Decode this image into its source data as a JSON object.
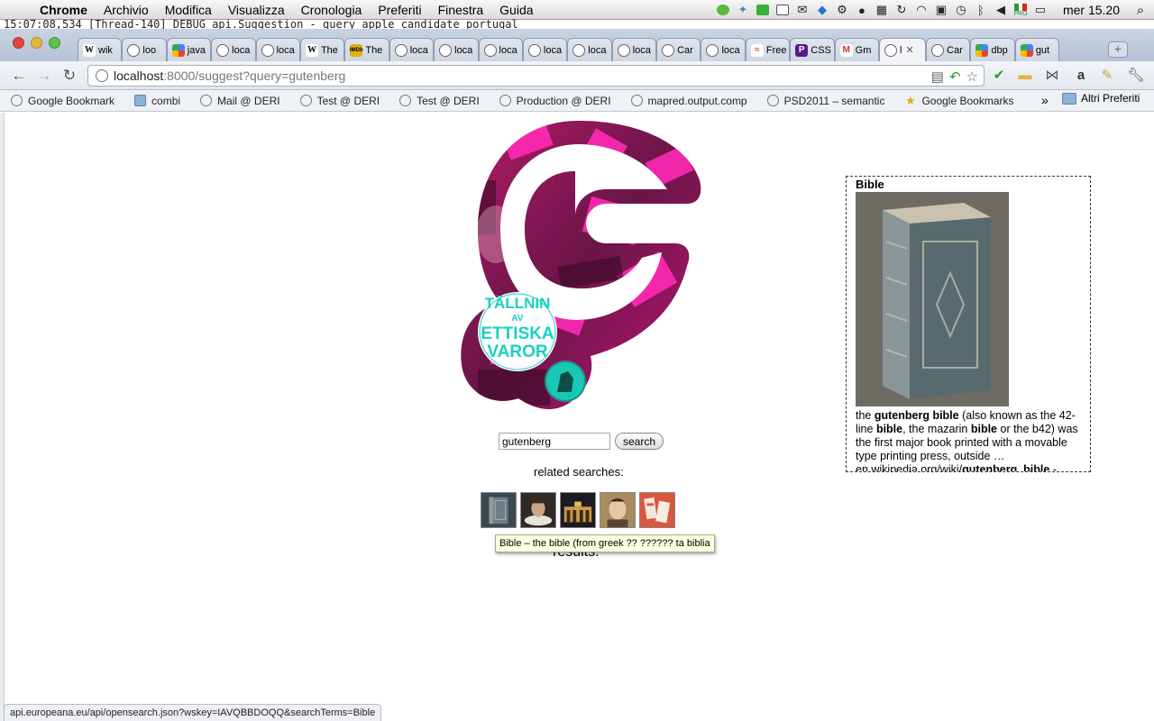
{
  "menubar": {
    "app": "Chrome",
    "items": [
      "Archivio",
      "Modifica",
      "Visualizza",
      "Cronologia",
      "Preferiti",
      "Finestra",
      "Guida"
    ],
    "clock": "mer 15.20",
    "flag_label": "PRO"
  },
  "log_line": "15:07:08,534 [Thread-140] DEBUG api.Suggestion - query apple candidate portugal",
  "tabs": [
    {
      "label": "wik",
      "icon": "W"
    },
    {
      "label": "loo",
      "icon": "globe"
    },
    {
      "label": "java",
      "icon": "google"
    },
    {
      "label": "loca",
      "icon": "globe"
    },
    {
      "label": "loca",
      "icon": "globe"
    },
    {
      "label": "The",
      "icon": "W"
    },
    {
      "label": "The",
      "icon": "IMDb"
    },
    {
      "label": "loca",
      "icon": "globe"
    },
    {
      "label": "loca",
      "icon": "globe"
    },
    {
      "label": "loca",
      "icon": "globe"
    },
    {
      "label": "loca",
      "icon": "globe"
    },
    {
      "label": "loca",
      "icon": "globe"
    },
    {
      "label": "loca",
      "icon": "globe"
    },
    {
      "label": "Car",
      "icon": "globe"
    },
    {
      "label": "loca",
      "icon": "globe"
    },
    {
      "label": "Free",
      "icon": "F"
    },
    {
      "label": "CSS",
      "icon": "P"
    },
    {
      "label": "Gm",
      "icon": "M"
    },
    {
      "label": "l",
      "icon": "globe",
      "active": true
    },
    {
      "label": "Car",
      "icon": "globe"
    },
    {
      "label": "dbp",
      "icon": "google"
    },
    {
      "label": "gut",
      "icon": "google"
    }
  ],
  "toolbar": {
    "url_host": "localhost",
    "url_rest": ":8000/suggest?query=gutenberg"
  },
  "bookmarks": [
    {
      "label": "Google Bookmark",
      "icon": "globe"
    },
    {
      "label": "combi",
      "icon": "folder"
    },
    {
      "label": "Mail @ DERI",
      "icon": "globe"
    },
    {
      "label": "Test @ DERI",
      "icon": "globe"
    },
    {
      "label": "Test @ DERI",
      "icon": "globe"
    },
    {
      "label": "Production @ DERI",
      "icon": "globe"
    },
    {
      "label": "mapred.output.comp",
      "icon": "globe"
    },
    {
      "label": "PSD2011 – semantic",
      "icon": "globe"
    },
    {
      "label": "Google Bookmarks",
      "icon": "star"
    }
  ],
  "bookmarks_more": "»",
  "bookmarks_other": "Altri Preferiti",
  "logo": {
    "badge_lines": [
      "TÄLLNIN",
      "AV",
      "ETTISKA",
      "VAROR"
    ]
  },
  "search": {
    "query": "gutenberg",
    "button": "search"
  },
  "related": {
    "label": "related searches:",
    "thumbnails": [
      "bible-book",
      "portrait-ruff",
      "night-gate",
      "portrait-painting",
      "leaflets"
    ]
  },
  "tooltip": "Bible – the bible (from greek ?? ?????? ta biblia",
  "results_label": "results:",
  "sidebox": {
    "title": "Bible",
    "text_html_parts": [
      {
        "t": "the "
      },
      {
        "b": "gutenberg bible"
      },
      {
        "t": " (also known as the 42-line "
      },
      {
        "b": "bible"
      },
      {
        "t": ", the mazarin "
      },
      {
        "b": "bible"
      },
      {
        "t": " or the b42) was the first major book printed with a movable type printing press, outside …en.wikipedia.org/wiki/"
      },
      {
        "b": "gutenberg_bible"
      },
      {
        "t": " -"
      }
    ]
  },
  "statusbar": "api.europeana.eu/api/opensearch.json?wskey=IAVQBBDOQQ&searchTerms=Bible",
  "colors": {
    "brand": "#e6127d",
    "teal": "#19d1c1"
  }
}
